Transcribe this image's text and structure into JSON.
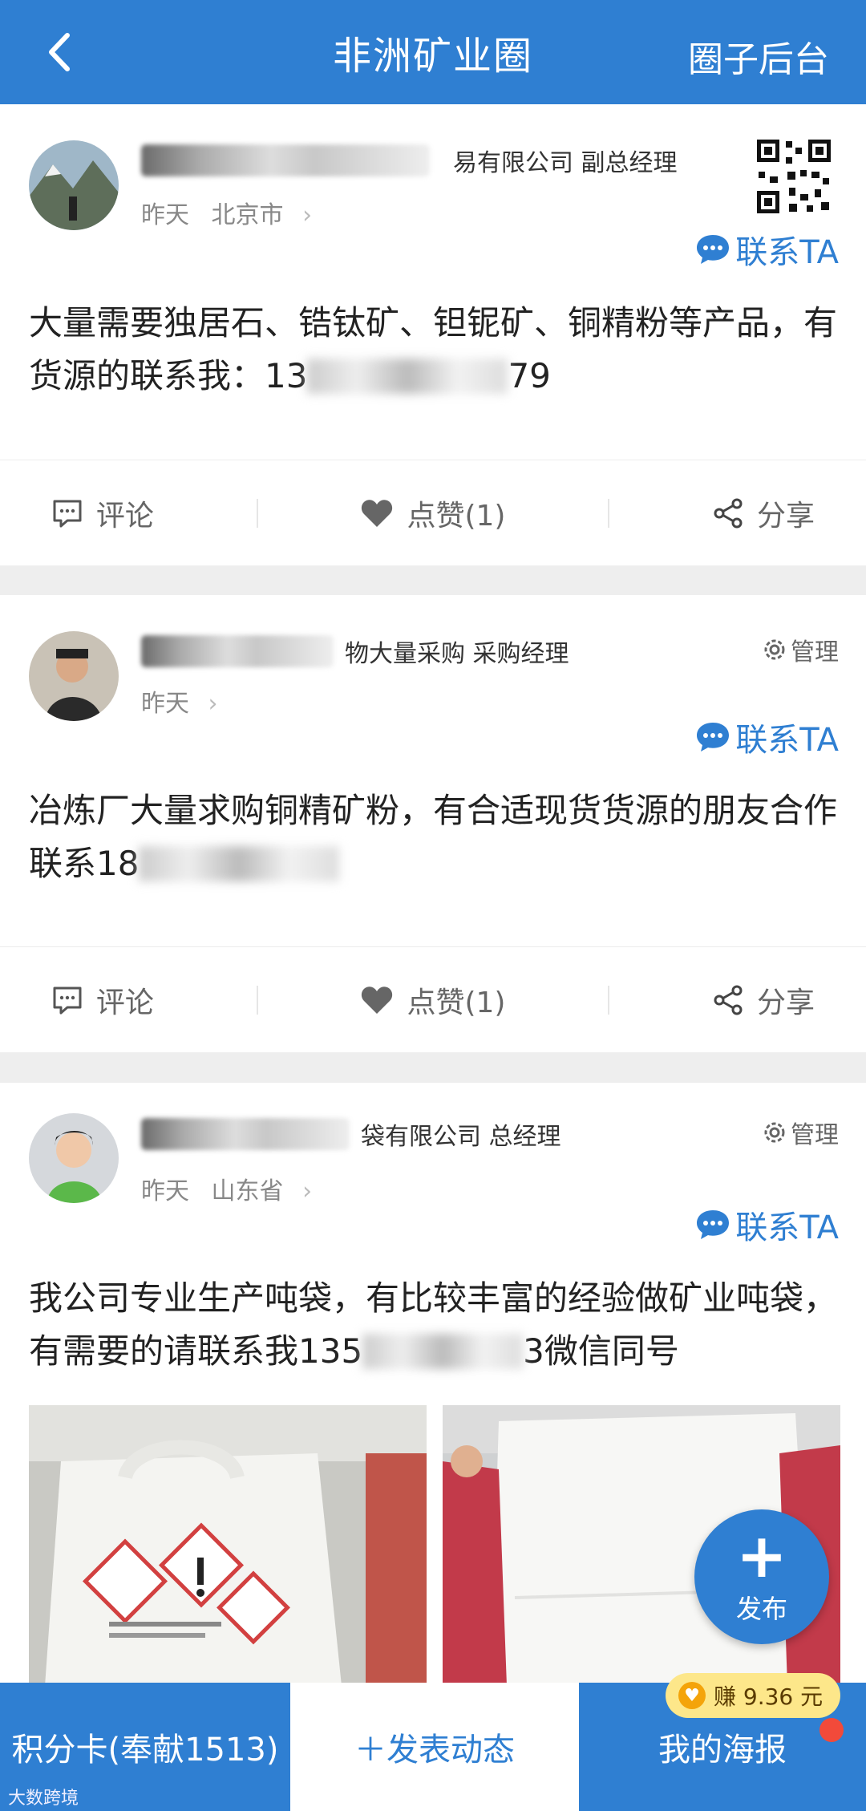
{
  "header": {
    "title": "非洲矿业圈",
    "right_label": "圈子后台"
  },
  "posts": [
    {
      "company": "易有限公司 副总经理",
      "time": "昨天",
      "location": "北京市",
      "contact": "联系TA",
      "content_prefix": "大量需要独居石、锆钛矿、钽铌矿、铜精粉等产品，有货源的联系我：13",
      "content_suffix": "79",
      "comment": "评论",
      "like": "点赞(1)",
      "share": "分享"
    },
    {
      "company": "物大量采购 采购经理",
      "time": "昨天",
      "manage": "管理",
      "contact": "联系TA",
      "content_prefix": "冶炼厂大量求购铜精矿粉，有合适现货货源的朋友合作联系18",
      "content_suffix": "",
      "comment": "评论",
      "like": "点赞(1)",
      "share": "分享"
    },
    {
      "company": "袋有限公司 总经理",
      "time": "昨天",
      "location": "山东省",
      "manage": "管理",
      "contact": "联系TA",
      "content_prefix": "我公司专业生产吨袋，有比较丰富的经验做矿业吨袋，有需要的请联系我135",
      "content_suffix": "3微信同号"
    }
  ],
  "fab": {
    "label": "发布"
  },
  "bottom_bar": {
    "points_card": "积分卡(奉献1513)",
    "post_dynamic": "＋发表动态",
    "my_poster": "我的海报",
    "earn_badge": "赚 9.36 元"
  },
  "watermark": "大数跨境",
  "colors": {
    "primary": "#2f7fd2",
    "badge": "#fde78a",
    "dot": "#f24a3a"
  }
}
